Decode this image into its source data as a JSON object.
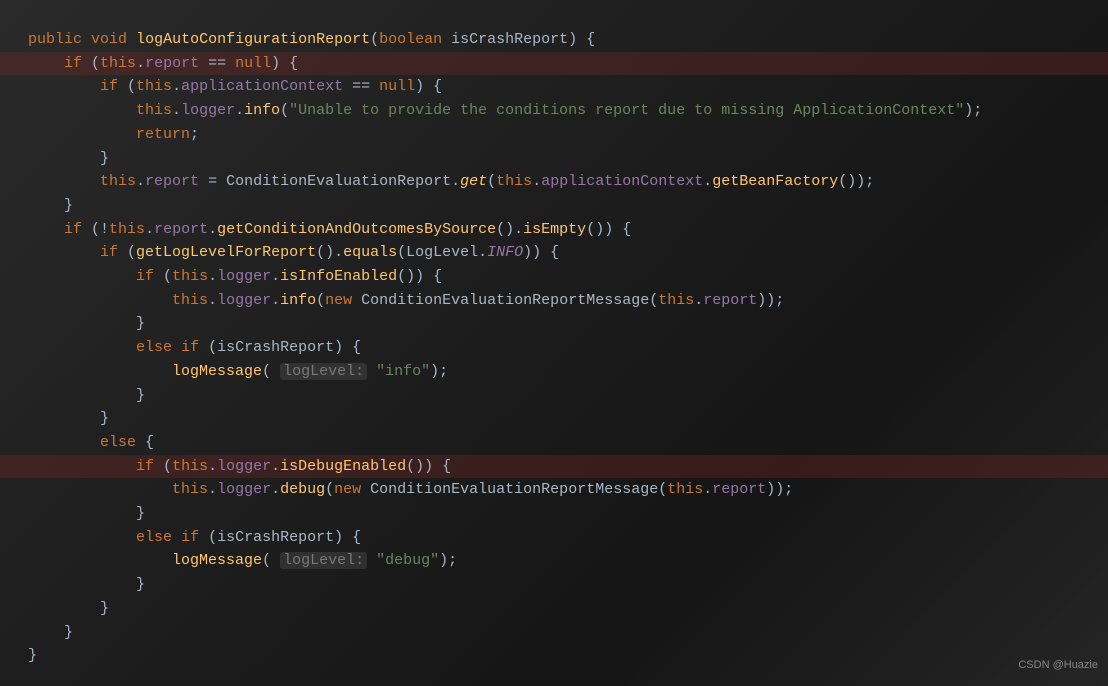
{
  "code": {
    "modifier_public": "public",
    "modifier_void": "void",
    "method_name": "logAutoConfigurationReport",
    "param_type": "boolean",
    "param_name": "isCrashReport",
    "kw_if": "if",
    "kw_else": "else",
    "kw_this": "this",
    "kw_null": "null",
    "kw_return": "return",
    "kw_new": "new",
    "field_report": "report",
    "field_applicationContext": "applicationContext",
    "field_logger": "logger",
    "method_info": "info",
    "method_debug": "debug",
    "method_isInfoEnabled": "isInfoEnabled",
    "method_isDebugEnabled": "isDebugEnabled",
    "method_getConditionAndOutcomesBySource": "getConditionAndOutcomesBySource",
    "method_isEmpty": "isEmpty",
    "method_getLogLevelForReport": "getLogLevelForReport",
    "method_equals": "equals",
    "method_getBeanFactory": "getBeanFactory",
    "method_logMessage": "logMessage",
    "type_ConditionEvaluationReport": "ConditionEvaluationReport",
    "type_ConditionEvaluationReportMessage": "ConditionEvaluationReportMessage",
    "type_LogLevel": "LogLevel",
    "static_get": "get",
    "const_INFO": "INFO",
    "str_unable": "\"Unable to provide the conditions report due to missing ApplicationContext\"",
    "str_info": "\"info\"",
    "str_debug": "\"debug\"",
    "hint_logLevel": "logLevel:"
  },
  "watermark": "CSDN @Huazie"
}
